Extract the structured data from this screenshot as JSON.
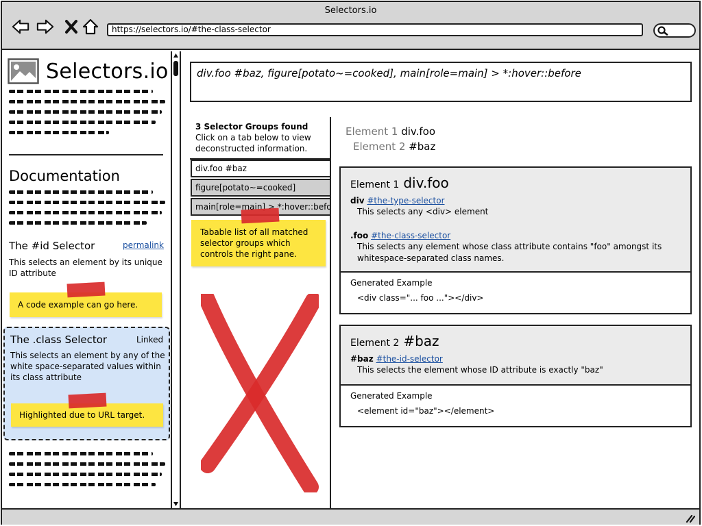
{
  "browser": {
    "title": "Selectors.io",
    "url": "https://selectors.io/#the-class-selector",
    "icons": [
      "back-arrow-icon",
      "forward-arrow-icon",
      "close-x-icon",
      "home-icon",
      "search-icon"
    ]
  },
  "sidebar": {
    "logo_text": "Selectors.io",
    "documentation_heading": "Documentation",
    "id_section": {
      "heading": "The #id Selector",
      "permalink": "permalink",
      "description": "This selects an element by its unique ID attribute",
      "note": "A code example can go here."
    },
    "class_section": {
      "heading": "The .class Selector",
      "linked": "Linked",
      "description": "This selects an element by any of the white space-separated values within its class attribute",
      "note": "Highlighted due to URL target."
    }
  },
  "main": {
    "selector_input": "div.foo #baz, figure[potato~=cooked], main[role=main] > *:hover::before",
    "groups_found": "3 Selector Groups found",
    "groups_hint": "Click on a tab below to view deconstructed information.",
    "tabs": [
      {
        "label": "div.foo #baz"
      },
      {
        "label": "figure[potato~=cooked]"
      },
      {
        "label": "main[role=main] > *:hover::before"
      }
    ],
    "tabs_note": "Tabable list of all matched selector groups which controls the right pane.",
    "element_summary": [
      {
        "label": "Element 1",
        "value": "div.foo"
      },
      {
        "label": "Element 2",
        "value": "#baz"
      }
    ],
    "elements": [
      {
        "label": "Element 1",
        "selector": "div.foo",
        "parts": [
          {
            "token": "div",
            "link": "#the-type-selector",
            "description": "This selects any <div> element"
          },
          {
            "token": ".foo",
            "link": "#the-class-selector",
            "description": "This selects any element whose class attribute contains \"foo\" amongst its whitespace-separated class names."
          }
        ],
        "generated_label": "Generated Example",
        "generated_code": "<div class=\"... foo ...\"></div>"
      },
      {
        "label": "Element 2",
        "selector": "#baz",
        "parts": [
          {
            "token": "#baz",
            "link": "#the-id-selector",
            "description": "This selects the element whose ID attribute is exactly \"baz\""
          }
        ],
        "generated_label": "Generated Example",
        "generated_code": "<element id=\"baz\"></element>"
      }
    ]
  },
  "colors": {
    "chrome": "#d6d6d6",
    "sticky_note": "#fde541",
    "tape": "#d92b2b",
    "highlight": "#d4e4f8",
    "link": "#1a4fa0"
  }
}
